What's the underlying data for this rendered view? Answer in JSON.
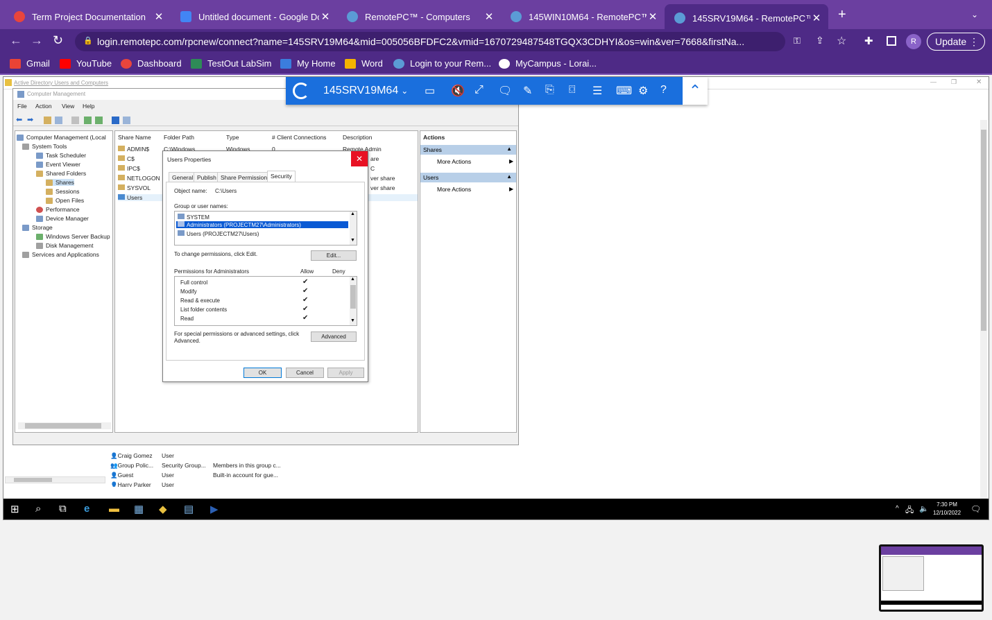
{
  "tabs": [
    {
      "title": "Term Project Documentation",
      "icon_color": "#e8453c"
    },
    {
      "title": "Untitled document - Google Dc",
      "icon_color": "#4285f4"
    },
    {
      "title": "RemotePC™ - Computers",
      "icon_color": "#5b9bd5"
    },
    {
      "title": "145WIN10M64 - RemotePC™ \\",
      "icon_color": "#5b9bd5"
    },
    {
      "title": "145SRV19M64 - RemotePC™ \\",
      "icon_color": "#5b9bd5"
    }
  ],
  "address": {
    "url": "login.remotepc.com/rpcnew/connect?name=145SRV19M64&mid=005056BFDFC2&vmid=1670729487548TGQX3CDHYI&os=win&ver=7668&firstNa...",
    "update_label": "Update",
    "profile": "R"
  },
  "bookmarks": [
    {
      "label": "Gmail",
      "color": "#ea4335"
    },
    {
      "label": "YouTube",
      "color": "#ff0000"
    },
    {
      "label": "Dashboard",
      "color": "#e8453c"
    },
    {
      "label": "TestOut LabSim",
      "color": "#2e8b57"
    },
    {
      "label": "My Home",
      "color": "#3b7ddd"
    },
    {
      "label": "Word",
      "color": "#f4b400"
    },
    {
      "label": "Login to your Rem...",
      "color": "#5b9bd5"
    },
    {
      "label": "MyCampus - Lorai...",
      "color": "#ffffff"
    }
  ],
  "rpc": {
    "computer": "145SRV19M64"
  },
  "bg_window": {
    "title": "Active Directory Users and Computers"
  },
  "mmc": {
    "title": "Computer Management",
    "menu": [
      "File",
      "Action",
      "View",
      "Help"
    ],
    "tree": [
      {
        "label": "Computer Management (Local",
        "indent": 0
      },
      {
        "label": "System Tools",
        "indent": 1
      },
      {
        "label": "Task Scheduler",
        "indent": 2
      },
      {
        "label": "Event Viewer",
        "indent": 2
      },
      {
        "label": "Shared Folders",
        "indent": 2
      },
      {
        "label": "Shares",
        "indent": 3
      },
      {
        "label": "Sessions",
        "indent": 3
      },
      {
        "label": "Open Files",
        "indent": 3
      },
      {
        "label": "Performance",
        "indent": 2
      },
      {
        "label": "Device Manager",
        "indent": 2
      },
      {
        "label": "Storage",
        "indent": 1
      },
      {
        "label": "Windows Server Backup",
        "indent": 2
      },
      {
        "label": "Disk Management",
        "indent": 2
      },
      {
        "label": "Services and Applications",
        "indent": 1
      }
    ],
    "columns": [
      "Share Name",
      "Folder Path",
      "Type",
      "# Client Connections",
      "Description"
    ],
    "shares": [
      {
        "name": "ADMIN$",
        "path": "C:\\Windows",
        "type": "Windows",
        "conn": "0",
        "desc": "Remote Admin"
      },
      {
        "name": "C$",
        "path": "",
        "type": "",
        "conn": "",
        "desc": "are"
      },
      {
        "name": "IPC$",
        "path": "",
        "type": "",
        "conn": "",
        "desc": "C"
      },
      {
        "name": "NETLOGON",
        "path": "",
        "type": "",
        "conn": "",
        "desc": "ver share"
      },
      {
        "name": "SYSVOL",
        "path": "",
        "type": "",
        "conn": "",
        "desc": "ver share"
      },
      {
        "name": "Users",
        "path": "",
        "type": "",
        "conn": "",
        "desc": ""
      }
    ],
    "actions": {
      "header": "Actions",
      "sec1": "Shares",
      "more1": "More Actions",
      "sec2": "Users",
      "more2": "More Actions"
    }
  },
  "dialog": {
    "title": "Users Properties",
    "tabs": [
      "General",
      "Publish",
      "Share Permissions",
      "Security"
    ],
    "object_label": "Object name:",
    "object_value": "C:\\Users",
    "group_label": "Group or user names:",
    "groups": [
      "SYSTEM",
      "Administrators (PROJECTM27\\Administrators)",
      "Users (PROJECTM27\\Users)"
    ],
    "change_text": "To change permissions, click Edit.",
    "edit_btn": "Edit...",
    "perm_label": "Permissions for Administrators",
    "allow": "Allow",
    "deny": "Deny",
    "permissions": [
      "Full control",
      "Modify",
      "Read & execute",
      "List folder contents",
      "Read"
    ],
    "special_text": "For special permissions or advanced settings, click Advanced.",
    "advanced_btn": "Advanced",
    "ok": "OK",
    "cancel": "Cancel",
    "apply": "Apply"
  },
  "ad_rows": [
    {
      "name": "Craig Gomez",
      "type": "User",
      "desc": ""
    },
    {
      "name": "Group Polic...",
      "type": "Security Group...",
      "desc": "Members in this group c..."
    },
    {
      "name": "Guest",
      "type": "User",
      "desc": "Built-in account for gue..."
    },
    {
      "name": "Harry Parker",
      "type": "User",
      "desc": ""
    }
  ],
  "taskbar": {
    "time": "7:30 PM",
    "date": "12/10/2022"
  }
}
